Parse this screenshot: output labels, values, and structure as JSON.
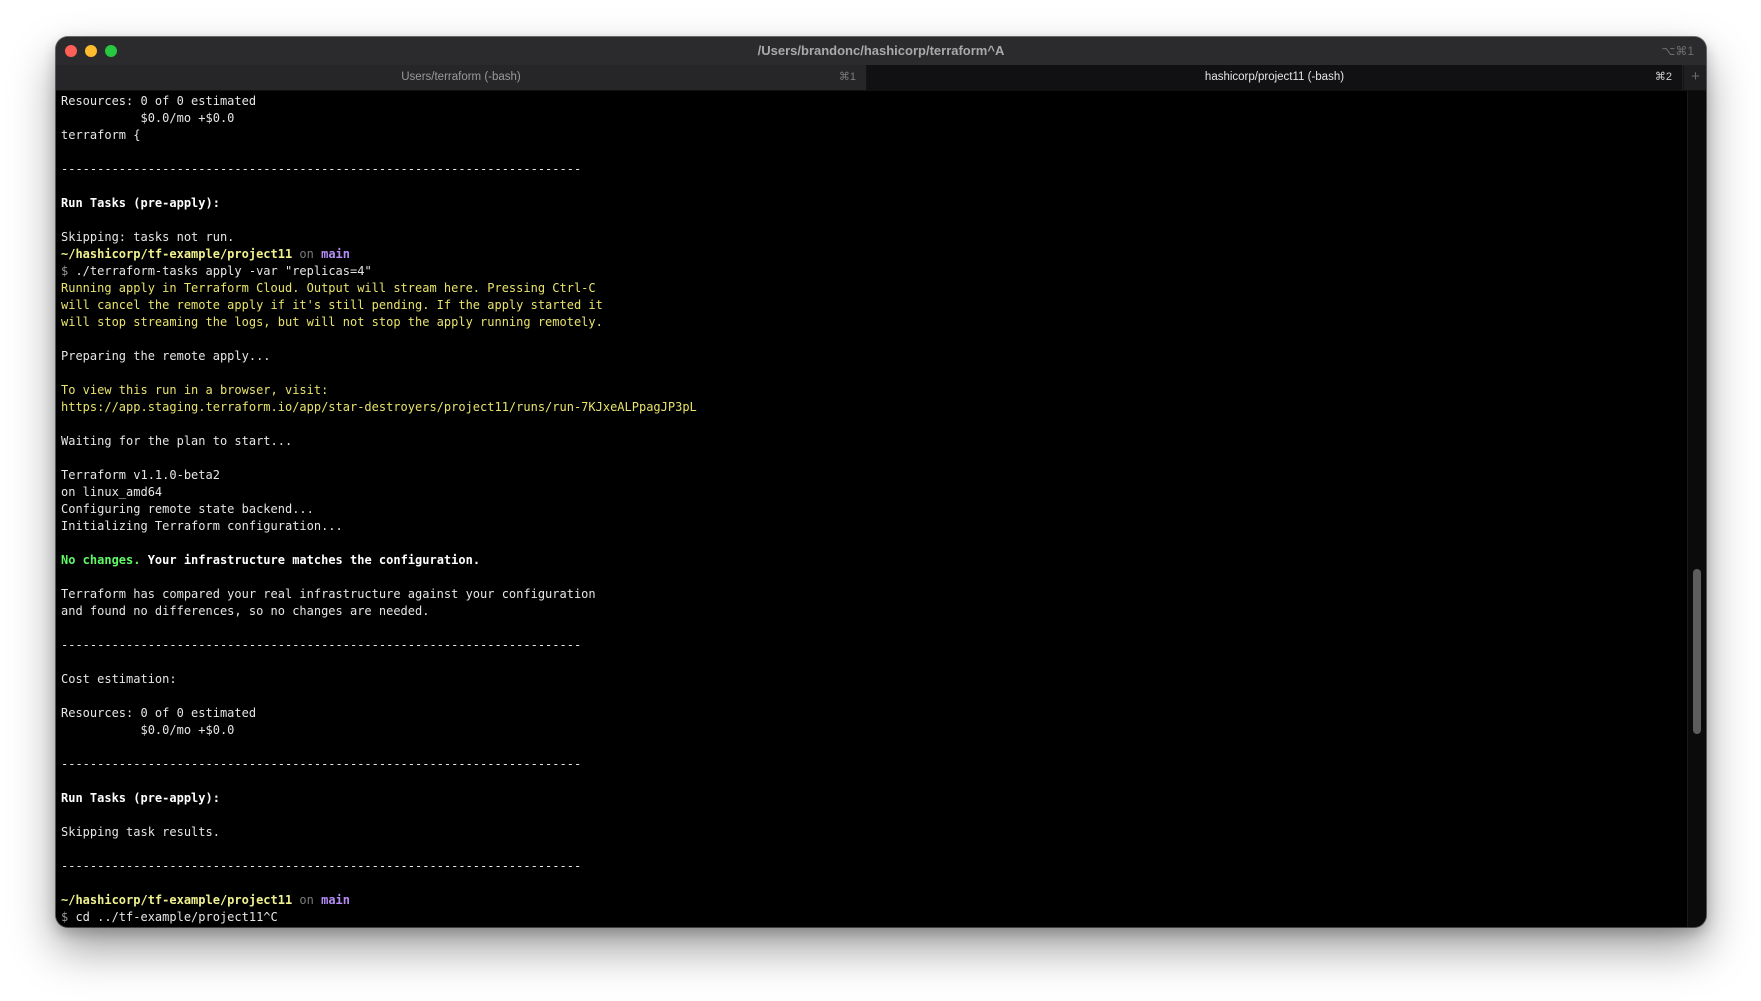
{
  "window": {
    "title": "/Users/brandonc/hashicorp/terraform^A",
    "shortcut_hint": "⌥⌘1"
  },
  "tabs": [
    {
      "label": "Users/terraform (-bash)",
      "shortcut": "⌘1",
      "active": false
    },
    {
      "label": "hashicorp/project11 (-bash)",
      "shortcut": "⌘2",
      "active": true
    }
  ],
  "new_tab_symbol": "+",
  "colors": {
    "terminal_bg": "#000000",
    "default_text": "#e6e6e6",
    "yellow_text": "#e8e36b",
    "green_text": "#5ff967",
    "branch_text": "#b58cf5"
  },
  "terminal": {
    "lines": [
      [
        {
          "t": "Resources: 0 of 0 estimated",
          "s": "default"
        }
      ],
      [
        {
          "t": "           $0.0/mo +$0.0",
          "s": "default"
        }
      ],
      [
        {
          "t": "terraform {",
          "s": "default"
        }
      ],
      [],
      [
        {
          "t": "------------------------------------------------------------------------",
          "s": "default"
        }
      ],
      [],
      [
        {
          "t": "Run Tasks (pre-apply):",
          "s": "bold"
        }
      ],
      [],
      [
        {
          "t": "Skipping: tasks not run.",
          "s": "default"
        }
      ],
      [
        {
          "t": "~/hashicorp/tf-example/project11",
          "s": "path"
        },
        {
          "t": " on ",
          "s": "dim"
        },
        {
          "t": "main",
          "s": "branch"
        }
      ],
      [
        {
          "t": "$ ",
          "s": "gray"
        },
        {
          "t": "./terraform-tasks apply -var \"replicas=4\"",
          "s": "default"
        }
      ],
      [
        {
          "t": "Running apply in Terraform Cloud. Output will stream here. Pressing Ctrl-C",
          "s": "yellow"
        }
      ],
      [
        {
          "t": "will cancel the remote apply if it's still pending. If the apply started it",
          "s": "yellow"
        }
      ],
      [
        {
          "t": "will stop streaming the logs, but will not stop the apply running remotely.",
          "s": "yellow"
        }
      ],
      [],
      [
        {
          "t": "Preparing the remote apply...",
          "s": "default"
        }
      ],
      [],
      [
        {
          "t": "To view this run in a browser, visit:",
          "s": "yellow"
        }
      ],
      [
        {
          "t": "https://app.staging.terraform.io/app/star-destroyers/project11/runs/run-7KJxeALPpagJP3pL",
          "s": "yellow"
        }
      ],
      [],
      [
        {
          "t": "Waiting for the plan to start...",
          "s": "default"
        }
      ],
      [],
      [
        {
          "t": "Terraform v1.1.0-beta2",
          "s": "default"
        }
      ],
      [
        {
          "t": "on linux_amd64",
          "s": "default"
        }
      ],
      [
        {
          "t": "Configuring remote state backend...",
          "s": "default"
        }
      ],
      [
        {
          "t": "Initializing Terraform configuration...",
          "s": "default"
        }
      ],
      [],
      [
        {
          "t": "No changes.",
          "s": "green-bold"
        },
        {
          "t": " Your infrastructure matches the configuration.",
          "s": "bold"
        }
      ],
      [],
      [
        {
          "t": "Terraform has compared your real infrastructure against your configuration",
          "s": "default"
        }
      ],
      [
        {
          "t": "and found no differences, so no changes are needed.",
          "s": "default"
        }
      ],
      [],
      [
        {
          "t": "------------------------------------------------------------------------",
          "s": "default"
        }
      ],
      [],
      [
        {
          "t": "Cost estimation:",
          "s": "default"
        }
      ],
      [],
      [
        {
          "t": "Resources: 0 of 0 estimated",
          "s": "default"
        }
      ],
      [
        {
          "t": "           $0.0/mo +$0.0",
          "s": "default"
        }
      ],
      [],
      [
        {
          "t": "------------------------------------------------------------------------",
          "s": "default"
        }
      ],
      [],
      [
        {
          "t": "Run Tasks (pre-apply):",
          "s": "bold"
        }
      ],
      [],
      [
        {
          "t": "Skipping task results.",
          "s": "default"
        }
      ],
      [],
      [
        {
          "t": "------------------------------------------------------------------------",
          "s": "default"
        }
      ],
      [],
      [
        {
          "t": "~/hashicorp/tf-example/project11",
          "s": "path"
        },
        {
          "t": " on ",
          "s": "dim"
        },
        {
          "t": "main",
          "s": "branch"
        }
      ],
      [
        {
          "t": "$ ",
          "s": "gray"
        },
        {
          "t": "cd ../tf-example/project11^C",
          "s": "default"
        }
      ]
    ]
  }
}
